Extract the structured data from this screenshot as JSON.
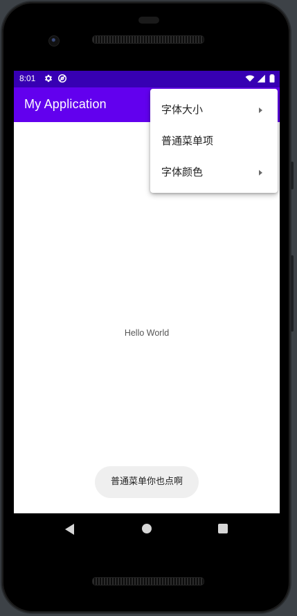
{
  "status_bar": {
    "time": "8:01",
    "left_icons": [
      "settings-gear-icon",
      "do-not-disturb-icon"
    ],
    "right_icons": [
      "wifi-icon",
      "signal-icon",
      "battery-icon"
    ]
  },
  "app_bar": {
    "title": "My Application"
  },
  "overflow_menu": {
    "items": [
      {
        "label": "字体大小",
        "has_submenu": true
      },
      {
        "label": "普通菜单项",
        "has_submenu": false
      },
      {
        "label": "字体颜色",
        "has_submenu": true
      }
    ]
  },
  "content": {
    "text": "Hello World"
  },
  "toast": {
    "message": "普通菜单你也点啊"
  },
  "nav_bar": {
    "buttons": [
      "back-icon",
      "home-icon",
      "recents-icon"
    ]
  },
  "colors": {
    "status_bar": "#3700b3",
    "app_bar": "#6200ee",
    "toast_bg": "#efefef"
  }
}
